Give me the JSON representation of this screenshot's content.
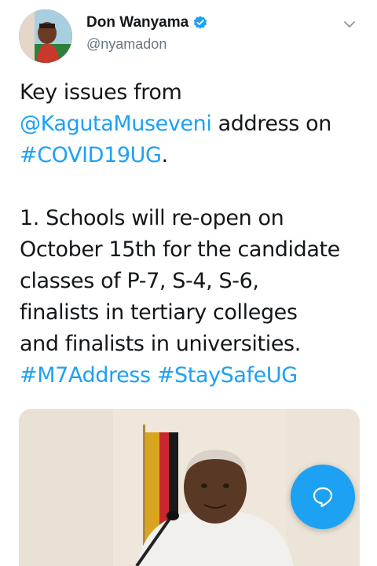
{
  "author": {
    "display_name": "Don Wanyama",
    "handle": "@nyamadon",
    "verified": true,
    "avatar_icon": "profile-photo"
  },
  "tweet": {
    "line1_prefix": "Key issues from",
    "mention": "@KagutaMuseveni",
    "line2_suffix": " address on",
    "hashtag_covid": "#COVID19UG",
    "period": ".",
    "body_lines": [
      "1. Schools will re-open on",
      "October 15th for the candidate",
      "classes of P-7, S-4, S-6,",
      "finalists in tertiary colleges",
      "and finalists in universities."
    ],
    "hashtag_address": "#M7Address",
    "hashtag_staysafe": "#StaySafeUG"
  },
  "colors": {
    "link": "#1da1f2",
    "text": "#14171a",
    "secondary": "#657786",
    "fab": "#1da1f2"
  },
  "icons": {
    "verified": "verified-badge-icon",
    "menu": "chevron-down-icon",
    "compose": "message-bubble-icon"
  }
}
